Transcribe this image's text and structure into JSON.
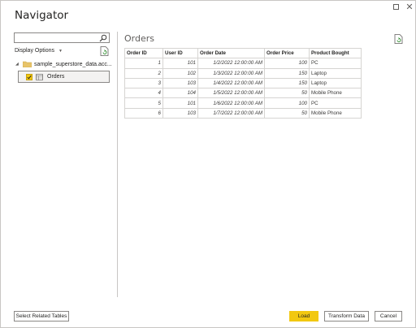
{
  "window": {
    "title": "Navigator",
    "maximize_glyph": "",
    "close_glyph": "✕"
  },
  "left_panel": {
    "search": {
      "value": "",
      "placeholder": ""
    },
    "display_options_label": "Display Options",
    "tree": {
      "root_label": "sample_superstore_data.acc...",
      "items": [
        {
          "label": "Orders",
          "checked": true
        }
      ]
    }
  },
  "preview": {
    "title": "Orders",
    "columns": [
      "Order ID",
      "User ID",
      "Order Date",
      "Order Price",
      "Product Bought"
    ],
    "rows": [
      [
        "1",
        "101",
        "1/2/2022 12:00:00 AM",
        "100",
        "PC"
      ],
      [
        "2",
        "102",
        "1/3/2022 12:00:00 AM",
        "150",
        "Laptop"
      ],
      [
        "3",
        "103",
        "1/4/2022 12:00:00 AM",
        "150",
        "Laptop"
      ],
      [
        "4",
        "104",
        "1/5/2022 12:00:00 AM",
        "50",
        "Mobile Phone"
      ],
      [
        "5",
        "101",
        "1/6/2022 12:00:00 AM",
        "100",
        "PC"
      ],
      [
        "6",
        "103",
        "1/7/2022 12:00:00 AM",
        "50",
        "Mobile Phone"
      ]
    ]
  },
  "buttons": {
    "select_related": "Select Related Tables",
    "load": "Load",
    "transform": "Transform Data",
    "cancel": "Cancel"
  },
  "colors": {
    "accent": "#f2c811",
    "border": "#8a8886",
    "folder": "#e8c46a"
  }
}
